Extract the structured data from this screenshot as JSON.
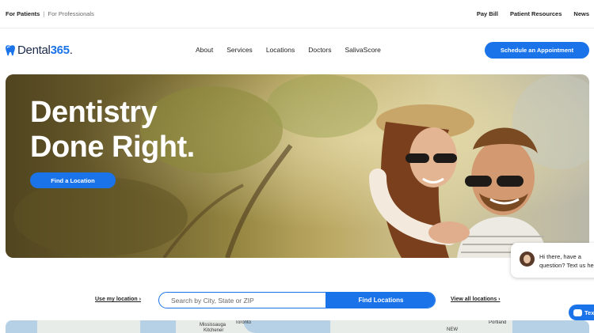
{
  "utility_bar": {
    "for_patients": "For Patients",
    "separator": "|",
    "for_professionals": "For Professionals",
    "links": [
      "Pay Bill",
      "Patient Resources",
      "News"
    ]
  },
  "nav": {
    "brand_prefix": "Dental",
    "brand_number": "365",
    "brand_suffix": ".",
    "links": [
      "About",
      "Services",
      "Locations",
      "Doctors",
      "SalivaScore"
    ],
    "cta_label": "Schedule an Appointment"
  },
  "hero": {
    "title_line1": "Dentistry",
    "title_line2": "Done Right.",
    "button_label": "Find a Location"
  },
  "chat": {
    "line1": "Hi there, have a",
    "line2": "question? Text us here."
  },
  "location_search": {
    "use_my_location": "Use my location ›",
    "placeholder": "Search by City, State or ZIP",
    "button_label": "Find Locations",
    "view_all": "View all locations ›"
  },
  "map": {
    "labels": [
      "Mississauga",
      "Toronto",
      "NEW",
      "Portland",
      "Kitchener"
    ]
  },
  "text_us": {
    "label": "Text"
  },
  "colors": {
    "accent": "#1a73e8",
    "text": "#222222"
  }
}
